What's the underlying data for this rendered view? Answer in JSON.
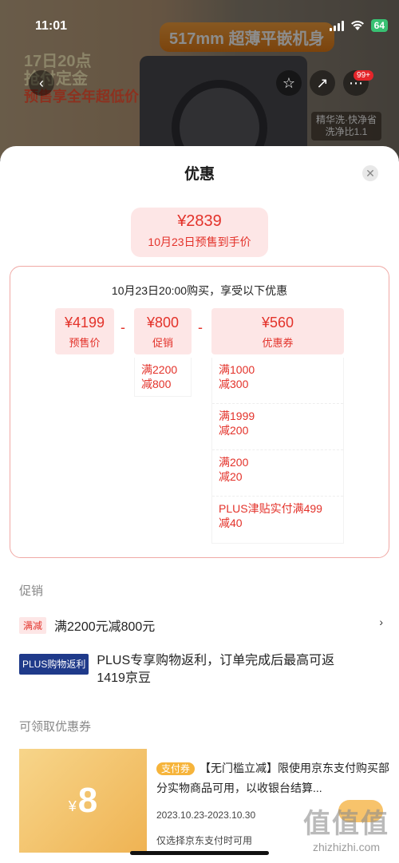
{
  "status_bar": {
    "time": "11:01",
    "battery": "64"
  },
  "background_page": {
    "promo_top": "517mm 超薄平嵌机身",
    "promo_left_line1": "17日20点",
    "promo_left_line2": "抢付定金",
    "promo_left_line3": "预售享全年超低价",
    "promo_right_line1": "精华洗·快净省",
    "promo_right_line2": "洗净比1.1",
    "cart_badge": "99+"
  },
  "sheet": {
    "title": "优惠",
    "final_price": {
      "amount": "¥2839",
      "label": "10月23日预售到手价"
    },
    "breakdown": {
      "header": "10月23日20:00购买，享受以下优惠",
      "items": [
        {
          "amount": "¥4199",
          "label": "预售价"
        },
        {
          "amount": "¥800",
          "label": "促销"
        },
        {
          "amount": "¥560",
          "label": "优惠券"
        }
      ],
      "minus": "-",
      "promo_detail": [
        "满2200",
        "减800"
      ],
      "coupon_details": [
        {
          "line1": "满1000",
          "line2": "减300"
        },
        {
          "line1": "满1999",
          "line2": "减200"
        },
        {
          "line1": "满200",
          "line2": "减20"
        },
        {
          "line1": "PLUS津贴实付满499",
          "line2": "减40"
        }
      ]
    },
    "promotions": {
      "section_title": "促销",
      "rows": [
        {
          "tag": "满减",
          "text": "满2200元减800元"
        },
        {
          "tag": "PLUS购物返利",
          "text": "PLUS专享购物返利，订单完成后最高可返1419京豆"
        }
      ]
    },
    "coupons": {
      "section_title": "可领取优惠券",
      "items": [
        {
          "symbol": "¥",
          "value": "8",
          "tag": "支付券",
          "title": "【无门槛立减】限使用京东支付购买部分实物商品可用，以收银台结算...",
          "date": "2023.10.23-2023.10.30",
          "note": "仅选择京东支付时可用"
        }
      ]
    },
    "watermark": {
      "logo": "值",
      "url": "zhizhizhi.com"
    }
  },
  "colors": {
    "accent": "#e3322a",
    "accent_bg": "#fde6e6",
    "plus_tag": "#1f3a8a",
    "coupon_gold": "#efb353"
  }
}
